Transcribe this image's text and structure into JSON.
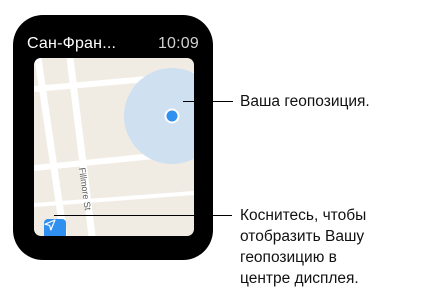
{
  "header": {
    "title": "Сан-Фран...",
    "time": "10:09"
  },
  "map": {
    "street_label": "Fillmore St",
    "colors": {
      "background": "#f1ece3",
      "road": "#ffffff",
      "location_halo": "#cfe0f0",
      "location_dot": "#2f90ef"
    }
  },
  "icons": {
    "locate_button": "location-arrow-icon",
    "location": "current-location-icon"
  },
  "callouts": {
    "location": "Ваша геопозиция.",
    "locate_lines": [
      "Коснитесь, чтобы",
      "отобразить Вашу",
      "геопозицию в",
      "центре дисплея."
    ]
  }
}
